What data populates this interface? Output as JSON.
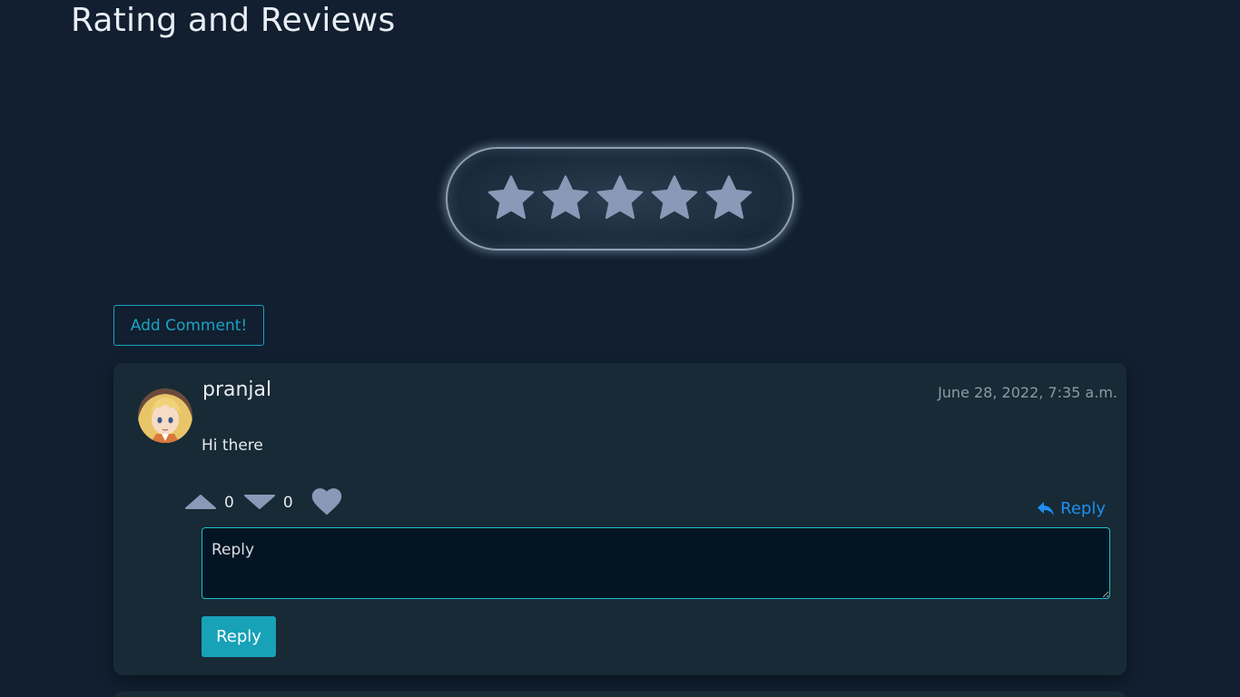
{
  "section": {
    "title": "Rating and Reviews"
  },
  "rating": {
    "max_stars": 5,
    "selected": 0,
    "star_color": "#8c98b7"
  },
  "add_comment_label": "Add Comment!",
  "comment": {
    "username": "pranjal",
    "timestamp": "June 28, 2022, 7:35 a.m.",
    "text": "Hi there",
    "upvotes": "0",
    "downvotes": "0",
    "reply_link_label": "Reply",
    "reply_placeholder": "Reply",
    "reply_button_label": "Reply"
  },
  "colors": {
    "background": "#111f30",
    "card": "#172a35",
    "accent": "#17a2b8",
    "link": "#1f8ef2",
    "icon": "#8c98b7"
  },
  "icons": {
    "star": "star-icon",
    "upvote": "caret-up-icon",
    "downvote": "caret-down-icon",
    "like": "heart-icon",
    "reply": "reply-arrow-icon"
  }
}
